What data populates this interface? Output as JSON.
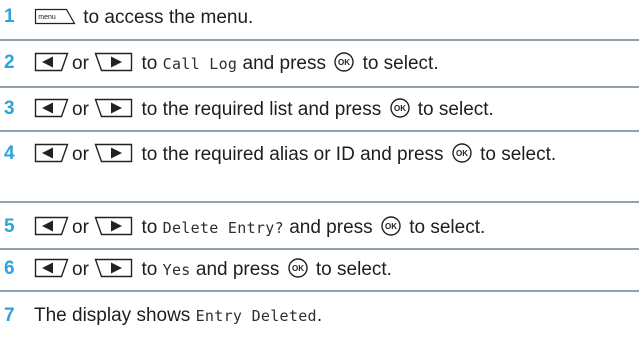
{
  "keys": {
    "menu_label": "menu",
    "ok_label": "OK",
    "or_label": "or"
  },
  "steps": [
    {
      "number": "1",
      "text": "to access the menu."
    },
    {
      "number": "2",
      "text_a": "to",
      "code": "Call Log",
      "text_b": "and press",
      "text_c": "to select."
    },
    {
      "number": "3",
      "text_a": "to the required list and press",
      "text_c": "to select."
    },
    {
      "number": "4",
      "text_a": "to the required alias or ID and press",
      "text_c": "to select."
    },
    {
      "number": "5",
      "text_a": "to",
      "code": "Delete Entry?",
      "text_b": "and press",
      "text_c": "to select."
    },
    {
      "number": "6",
      "text_a": "to",
      "code": "Yes",
      "text_b": "and press",
      "text_c": "to select."
    },
    {
      "number": "7",
      "text_a": "The display shows",
      "code": "Entry Deleted",
      "text_b": "."
    }
  ],
  "colors": {
    "step_number": "#2ea3d9",
    "divider": "#93a1ad"
  }
}
